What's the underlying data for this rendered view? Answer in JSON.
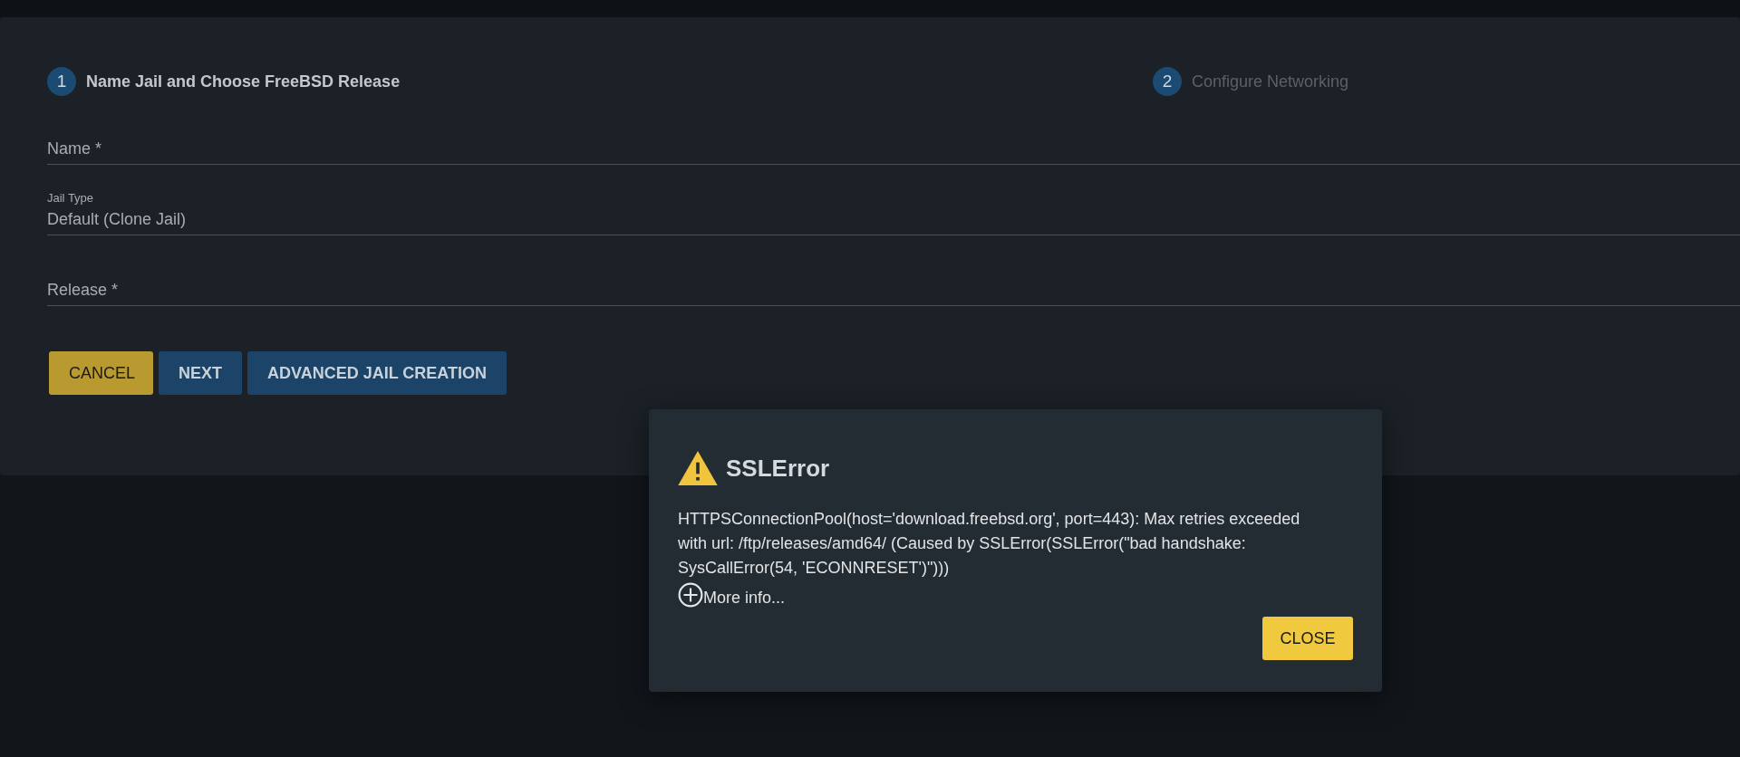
{
  "stepper": {
    "steps": [
      {
        "number": "1",
        "label": "Name Jail and Choose FreeBSD Release",
        "selected": true
      },
      {
        "number": "2",
        "label": "Configure Networking",
        "selected": false
      }
    ]
  },
  "form": {
    "fields": [
      {
        "kind": "input",
        "label": "Name *"
      },
      {
        "kind": "select",
        "label": "Jail Type",
        "value": "Default (Clone Jail)"
      },
      {
        "kind": "input",
        "label": "Release *"
      }
    ],
    "buttons": [
      {
        "label": "CANCEL",
        "kind": "warn"
      },
      {
        "label": "NEXT",
        "kind": "primary"
      },
      {
        "label": "ADVANCED JAIL CREATION",
        "kind": "primary"
      }
    ]
  },
  "dialog": {
    "title": "SSLError",
    "message": "HTTPSConnectionPool(host='download.freebsd.org', port=443): Max retries exceeded with url: /ftp/releases/amd64/ (Caused by SSLError(SSLError(\"bad handshake: SysCallError(54, 'ECONNRESET')\")))",
    "more_info": "More info...",
    "button": "CLOSE"
  }
}
